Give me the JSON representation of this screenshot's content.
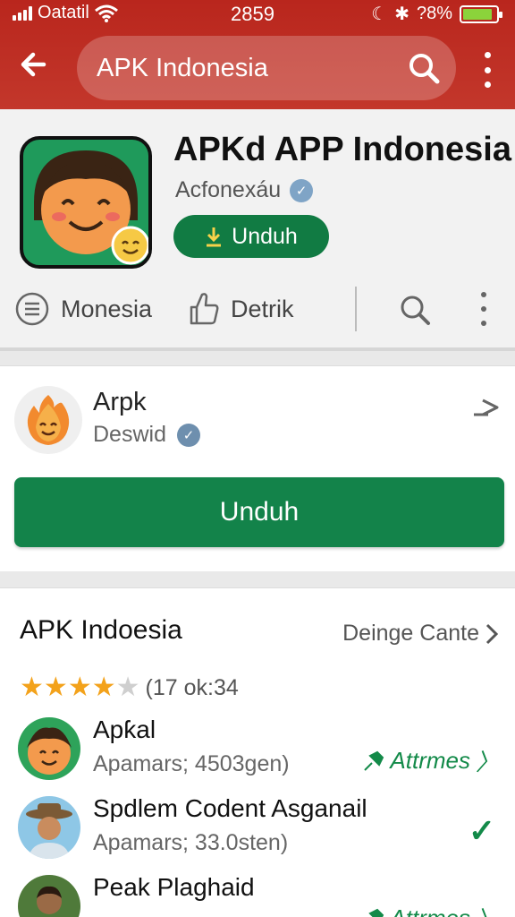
{
  "status_bar": {
    "carrier": "Oatatil",
    "clock": "2859",
    "battery_text": "?8%",
    "battery_level": 0.88
  },
  "toolbar": {
    "search_query": "APK Indonesia"
  },
  "app": {
    "title": "APKd APP Indonesia",
    "developer": "Acfonexáu",
    "download_label": "Unduh",
    "tabs": [
      "Monesia",
      "Detrik"
    ]
  },
  "featured": {
    "title": "Arpk",
    "subtitle": "Deswid",
    "button_label": "Unduh"
  },
  "section": {
    "title": "APK Indoesia",
    "link_label": "Deinge Cante",
    "rating_stars": 4,
    "rating_max": 5,
    "rating_text": "(17 ok:34",
    "items": [
      {
        "name": "Apƙal",
        "meta": "Apamars; 4503gen)",
        "action": "Attrmes"
      },
      {
        "name": "Spdlem Codent Asganail",
        "meta": "Apamars; 33.0sten)",
        "action": ""
      },
      {
        "name": "Peak Plaghaid",
        "meta": "",
        "action": "Attrmes"
      }
    ]
  },
  "colors": {
    "toolbar_red": "#c3372b",
    "brand_green": "#13834a",
    "star_gold": "#f3a21b"
  }
}
